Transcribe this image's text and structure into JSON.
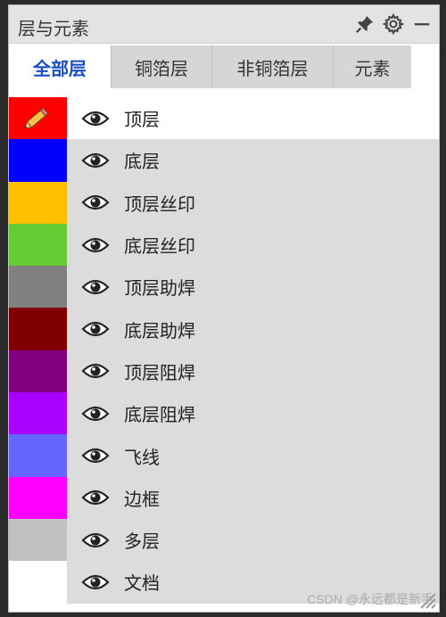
{
  "panel": {
    "title": "层与元素"
  },
  "tabs": [
    {
      "label": "全部层",
      "active": true
    },
    {
      "label": "铜箔层",
      "active": false
    },
    {
      "label": "非铜箔层",
      "active": false
    },
    {
      "label": "元素",
      "active": false
    }
  ],
  "layers": [
    {
      "label": "顶层",
      "color": "#ff0000",
      "selected": true
    },
    {
      "label": "底层",
      "color": "#0000ff",
      "selected": false
    },
    {
      "label": "顶层丝印",
      "color": "#ffc000",
      "selected": false
    },
    {
      "label": "底层丝印",
      "color": "#66cc33",
      "selected": false
    },
    {
      "label": "顶层助焊",
      "color": "#808080",
      "selected": false
    },
    {
      "label": "底层助焊",
      "color": "#800000",
      "selected": false
    },
    {
      "label": "顶层阻焊",
      "color": "#800080",
      "selected": false
    },
    {
      "label": "底层阻焊",
      "color": "#aa00ff",
      "selected": false
    },
    {
      "label": "飞线",
      "color": "#6666ff",
      "selected": false
    },
    {
      "label": "边框",
      "color": "#ff00ff",
      "selected": false
    },
    {
      "label": "多层",
      "color": "#c0c0c0",
      "selected": false
    },
    {
      "label": "文档",
      "color": "#ffffff",
      "selected": false
    }
  ],
  "icons": {
    "pin": "pin-icon",
    "settings": "gear-icon",
    "minimize": "minimize-icon",
    "visibility": "eye-icon",
    "edit": "pencil-icon"
  },
  "watermark": "CSDN @永远都是新手"
}
